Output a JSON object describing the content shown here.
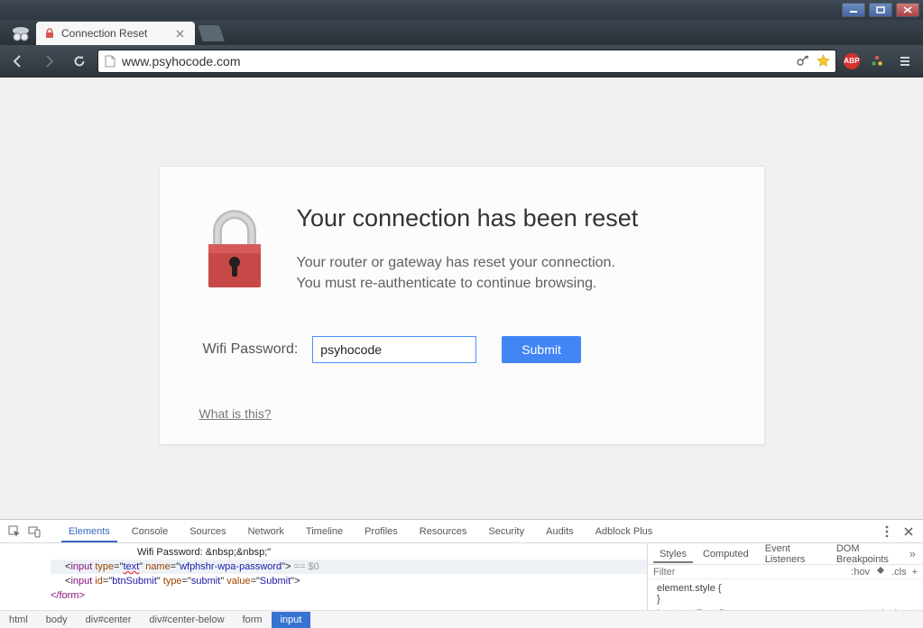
{
  "window": {
    "tab_title": "Connection Reset",
    "url": "www.psyhocode.com",
    "extensions": {
      "abp_label": "ABP"
    }
  },
  "page": {
    "heading": "Your connection has been reset",
    "line1": "Your router or gateway has reset your connection.",
    "line2": "You must re-authenticate to continue browsing.",
    "wifi_label": "Wifi Password:",
    "wifi_value": "psyhocode",
    "submit_label": "Submit",
    "what_link": "What is this?"
  },
  "devtools": {
    "tabs": [
      "Elements",
      "Console",
      "Sources",
      "Network",
      "Timeline",
      "Profiles",
      "Resources",
      "Security",
      "Audits",
      "Adblock Plus"
    ],
    "active_tab": "Elements",
    "styles_tabs": [
      "Styles",
      "Computed",
      "Event Listeners",
      "DOM Breakpoints"
    ],
    "styles_active": "Styles",
    "filter_placeholder": "Filter",
    "hov_label": ":hov",
    "cls_label": ".cls",
    "rule1": "element.style {",
    "rule1_close": "}",
    "rule2_left": "input:not([type])",
    "rule2_right": "user agent stylesheet",
    "elements_lines": {
      "l1": "Wifi Password: &nbsp;&nbsp;\"",
      "l2_pre": "<",
      "l2_tag": "input",
      "l2_a1n": " type",
      "l2_a1v": "=\"",
      "l2_a1vtext": "text",
      "l2_a1vend": "\"",
      "l2_a2n": " name",
      "l2_a2v": "=\"",
      "l2_a2vtext": "wfphshr-wpa-password",
      "l2_a2vend": "\"> ",
      "l2_tail": "== $0",
      "l3_pre": "<",
      "l3_tag": "input",
      "l3_a1n": " id",
      "l3_a1v": "=\"",
      "l3_a1vtext": "btnSubmit",
      "l3_a1vend": "\"",
      "l3_a2n": " type",
      "l3_a2v": "=\"",
      "l3_a2vtext": "submit",
      "l3_a2vend": "\"",
      "l3_a3n": " value",
      "l3_a3v": "=\"",
      "l3_a3vtext": "Submit",
      "l3_a3vend": "\">",
      "l4": "</form>"
    },
    "crumbs": [
      "html",
      "body",
      "div#center",
      "div#center-below",
      "form",
      "input"
    ],
    "active_crumb": "input"
  }
}
